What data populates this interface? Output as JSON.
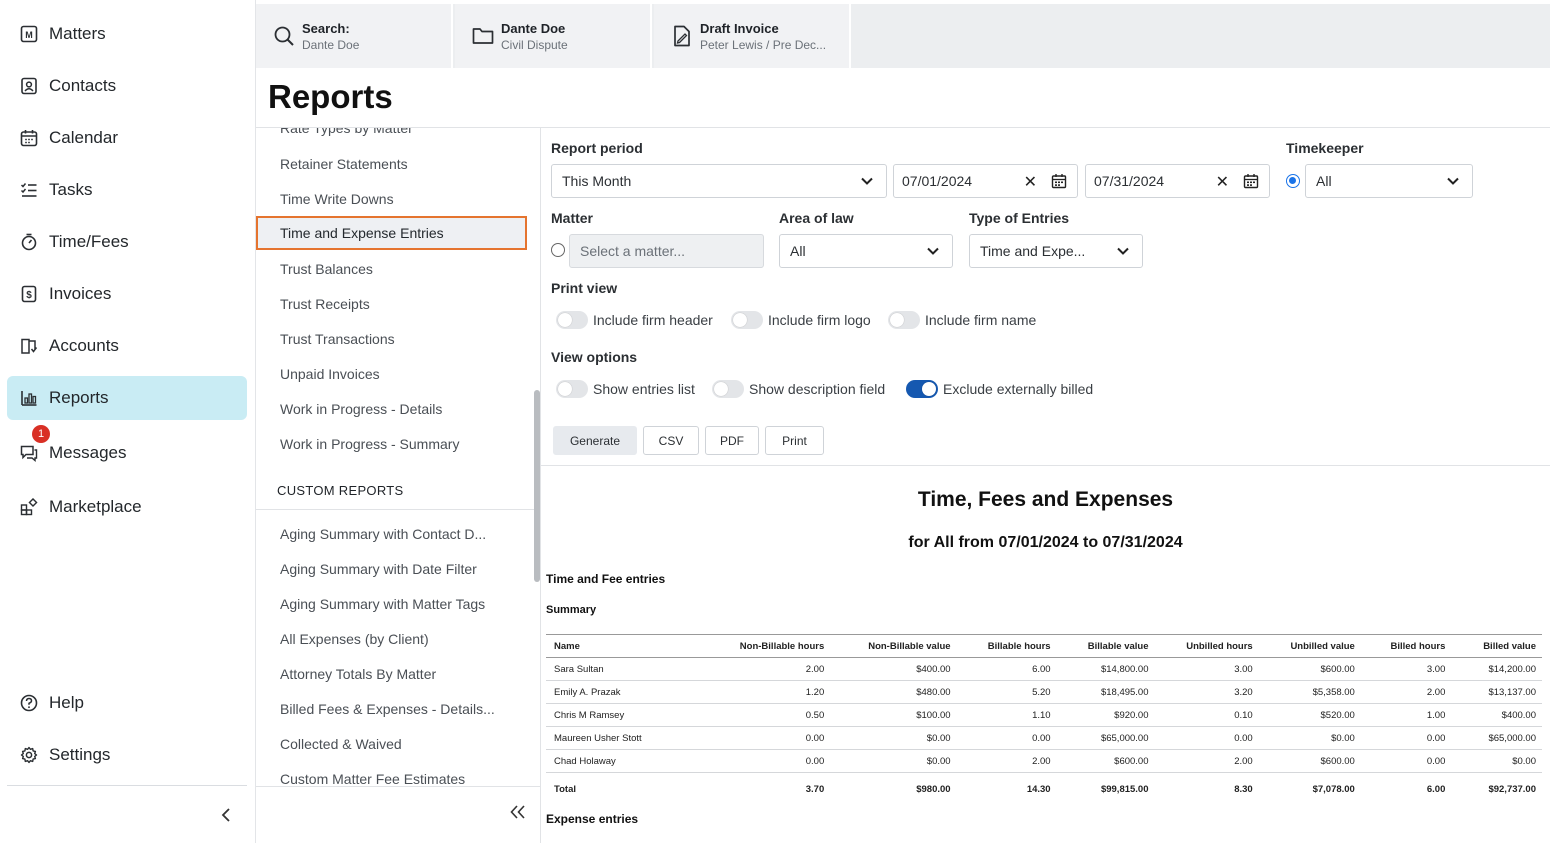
{
  "nav": {
    "items": [
      {
        "label": "Matters",
        "icon": "matters-icon"
      },
      {
        "label": "Contacts",
        "icon": "contacts-icon"
      },
      {
        "label": "Calendar",
        "icon": "calendar-icon"
      },
      {
        "label": "Tasks",
        "icon": "tasks-icon"
      },
      {
        "label": "Time/Fees",
        "icon": "timer-icon"
      },
      {
        "label": "Invoices",
        "icon": "invoice-icon"
      },
      {
        "label": "Accounts",
        "icon": "accounts-icon"
      },
      {
        "label": "Reports",
        "icon": "reports-icon"
      },
      {
        "label": "Messages",
        "icon": "messages-icon"
      },
      {
        "label": "Marketplace",
        "icon": "marketplace-icon"
      }
    ],
    "messages_badge": "1",
    "help": "Help",
    "settings": "Settings",
    "active_color": "#c9ecf4"
  },
  "tabs": [
    {
      "title": "Search:",
      "subtitle": "Dante Doe",
      "icon": "search-icon"
    },
    {
      "title": "Dante Doe",
      "subtitle": "Civil Dispute",
      "icon": "folder-icon"
    },
    {
      "title": "Draft Invoice",
      "subtitle": "Peter Lewis / Pre Dec...",
      "icon": "draft-invoice-icon"
    }
  ],
  "page": {
    "title": "Reports"
  },
  "report_list": {
    "items": [
      "Rate Types by Matter",
      "Retainer Statements",
      "Time Write Downs",
      "Time and Expense Entries",
      "Trust Balances",
      "Trust Receipts",
      "Trust Transactions",
      "Unpaid Invoices",
      "Work in Progress - Details",
      "Work in Progress - Summary"
    ],
    "custom_header": "CUSTOM REPORTS",
    "custom_items": [
      "Aging Summary with Contact D...",
      "Aging Summary with Date Filter",
      "Aging Summary with Matter Tags",
      "All Expenses (by Client)",
      "Attorney Totals By Matter",
      "Billed Fees & Expenses - Details...",
      "Collected & Waived",
      "Custom Matter Fee Estimates"
    ],
    "selected_color": "#e5742f"
  },
  "filters": {
    "report_period_label": "Report period",
    "report_period_value": "This Month",
    "date_from": "07/01/2024",
    "date_to": "07/31/2024",
    "timekeeper_label": "Timekeeper",
    "timekeeper_value": "All",
    "matter_label": "Matter",
    "matter_placeholder": "Select a matter...",
    "area_label": "Area of law",
    "area_value": "All",
    "type_label": "Type of Entries",
    "type_value": "Time and Expe...",
    "print_view_label": "Print view",
    "print_toggles": [
      "Include firm header",
      "Include firm logo",
      "Include firm name"
    ],
    "view_options_label": "View options",
    "view_toggles": [
      "Show entries list",
      "Show description field",
      "Exclude externally billed"
    ]
  },
  "actions": {
    "generate": "Generate",
    "csv": "CSV",
    "pdf": "PDF",
    "print": "Print"
  },
  "report": {
    "title": "Time, Fees and Expenses",
    "subtitle": "for All from 07/01/2024 to 07/31/2024",
    "section_time": "Time and Fee entries",
    "summary_label": "Summary",
    "section_expense": "Expense entries",
    "columns": [
      "Name",
      "Non-Billable hours",
      "Non-Billable value",
      "Billable hours",
      "Billable value",
      "Unbilled hours",
      "Unbilled value",
      "Billed hours",
      "Billed value"
    ],
    "rows": [
      [
        "Sara Sultan",
        "2.00",
        "$400.00",
        "6.00",
        "$14,800.00",
        "3.00",
        "$600.00",
        "3.00",
        "$14,200.00"
      ],
      [
        "Emily A. Prazak",
        "1.20",
        "$480.00",
        "5.20",
        "$18,495.00",
        "3.20",
        "$5,358.00",
        "2.00",
        "$13,137.00"
      ],
      [
        "Chris M Ramsey",
        "0.50",
        "$100.00",
        "1.10",
        "$920.00",
        "0.10",
        "$520.00",
        "1.00",
        "$400.00"
      ],
      [
        "Maureen Usher Stott",
        "0.00",
        "$0.00",
        "0.00",
        "$65,000.00",
        "0.00",
        "$0.00",
        "0.00",
        "$65,000.00"
      ],
      [
        "Chad Holaway",
        "0.00",
        "$0.00",
        "2.00",
        "$600.00",
        "2.00",
        "$600.00",
        "0.00",
        "$0.00"
      ]
    ],
    "total": [
      "Total",
      "3.70",
      "$980.00",
      "14.30",
      "$99,815.00",
      "8.30",
      "$7,078.00",
      "6.00",
      "$92,737.00"
    ]
  }
}
